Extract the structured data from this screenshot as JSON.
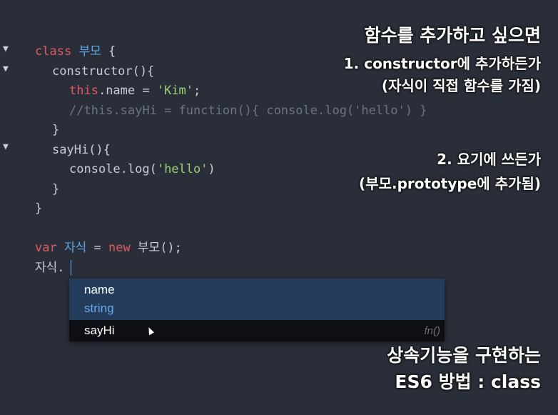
{
  "code": {
    "l1": {
      "kw": "class",
      "name": "부모",
      "rest": " {"
    },
    "l2": "constructor(){",
    "l3": {
      "this": "this",
      "mid": ".name = ",
      "str": "'Kim'",
      "end": ";"
    },
    "l4": "//this.sayHi = function(){ console.log('hello') }",
    "l5": "}",
    "l6": "sayHi(){",
    "l7": {
      "pre": "console.log(",
      "str": "'hello'",
      "end": ")"
    },
    "l8": "}",
    "l9": "}",
    "l11": {
      "kw": "var",
      "name": "자식",
      "eq": " = ",
      "new": "new",
      "call": " 부모();"
    },
    "l12": "자식."
  },
  "fold_markers": [
    "▼",
    "▼",
    "▼"
  ],
  "autocomplete": {
    "items": [
      {
        "label": "name",
        "type": "string"
      },
      {
        "label": "sayHi",
        "hint": "fn()"
      }
    ]
  },
  "overlay": {
    "heading": "함수를 추가하고 싶으면",
    "opt1_line1": "1. constructor에 추가하든가",
    "opt1_line2": "(자식이 직접 함수를 가짐)",
    "opt2_line1": "2. 요기에 쓰든가",
    "opt2_line2": "(부모.prototype에 추가됨)",
    "bottom_line1": "상속기능을 구현하는",
    "bottom_line2": "ES6 방법 : class"
  }
}
